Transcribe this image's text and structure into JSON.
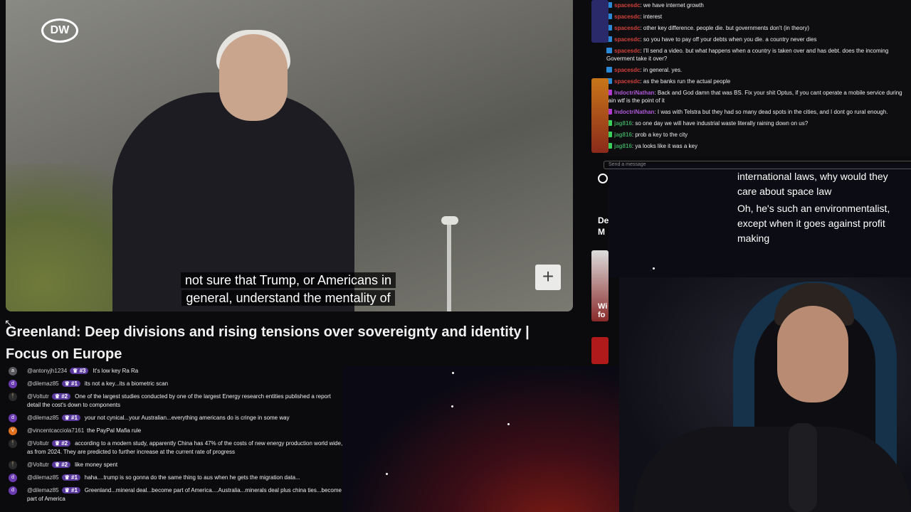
{
  "video": {
    "logo_text": "DW",
    "subtitle_line1": "not sure that Trump, or Americans in",
    "subtitle_line2": "general, understand the mentality of",
    "add_label": "+",
    "title": "Greenland: Deep divisions and rising tensions over sovereignty and identity | Focus on Europe"
  },
  "comments": [
    {
      "avatar": "a",
      "avatar_color": "#5a5a60",
      "user": "@antonyjh1234",
      "badge": "♛ #3",
      "text": "It's low key Ra Ra"
    },
    {
      "avatar": "d",
      "avatar_color": "#6a3ab0",
      "user": "@dilemaz85",
      "badge": "♛ #1",
      "text": "its not a key...its a biometric scan"
    },
    {
      "avatar": "🕴",
      "avatar_color": "#2a2a2a",
      "user": "@Voltutr",
      "badge": "♛ #2",
      "text": "One of the largest studies conducted by one of the largest Energy research entities published a report detail the cost's down to components"
    },
    {
      "avatar": "d",
      "avatar_color": "#6a3ab0",
      "user": "@dilemaz85",
      "badge": "♛ #1",
      "text": "your not cynical...your Australian...everything americans do is cringe in some way"
    },
    {
      "avatar": "V",
      "avatar_color": "#e0701c",
      "user": "@vincentcacciola7161",
      "badge": "",
      "text": "the PayPal Mafia rule"
    },
    {
      "avatar": "🕴",
      "avatar_color": "#2a2a2a",
      "user": "@Voltutr",
      "badge": "♛ #2",
      "text": "according to a modern study, apparently China has 47% of the costs of new energy production world wide, as from 2024. They are predicted to further increase at the current rate of progress"
    },
    {
      "avatar": "🕴",
      "avatar_color": "#2a2a2a",
      "user": "@Voltutr",
      "badge": "♛ #2",
      "text": "like money spent"
    },
    {
      "avatar": "d",
      "avatar_color": "#6a3ab0",
      "user": "@dilemaz85",
      "badge": "♛ #1",
      "text": "haha....trump is so gonna do the same thing to aus when he gets the migration data..."
    },
    {
      "avatar": "d",
      "avatar_color": "#6a3ab0",
      "user": "@dilemaz85",
      "badge": "♛ #1",
      "text": "Greenland...mineral deal...become part of America....Australia...minerals deal plus china ties...become part of America"
    }
  ],
  "chat": [
    {
      "user": "spacesdc",
      "color": "#d0403a",
      "ico": "#2a8ad8",
      "text": ": we have internet growth"
    },
    {
      "user": "spacesdc",
      "color": "#d0403a",
      "ico": "#2a8ad8",
      "text": ": interest"
    },
    {
      "user": "spacesdc",
      "color": "#d0403a",
      "ico": "#2a8ad8",
      "text": ": other key difference. people die. but governments don't (in theory)"
    },
    {
      "user": "spacesdc",
      "color": "#d0403a",
      "ico": "#2a8ad8",
      "text": ": so you have to pay off your debts when you die. a country never dies"
    },
    {
      "user": "spacesdc",
      "color": "#d0403a",
      "ico": "#2a8ad8",
      "text": ": I'll send a video. but what happens when a country is taken over and has debt. does the incoming Goverment take it over?"
    },
    {
      "user": "spacesdc",
      "color": "#d0403a",
      "ico": "#2a8ad8",
      "text": ": in general. yes."
    },
    {
      "user": "spacesdc",
      "color": "#d0403a",
      "ico": "#2a8ad8",
      "text": ": as the banks run the actual people"
    },
    {
      "user": "IndoctriNathan",
      "color": "#b05ad8",
      "ico": "#b03ad0",
      "text": ": Back and God damn that was BS. Fix your shit Optus, if you cant operate a mobile service during rain wtf is the point of it"
    },
    {
      "user": "IndoctriNathan",
      "color": "#b05ad8",
      "ico": "#b03ad0",
      "text": ": I was with Telstra but they had so many dead spots in the cities, and I dont go rural enough."
    },
    {
      "user": "jag816",
      "color": "#3aa05a",
      "ico": "#3ad05a",
      "text": ": so one day we will have industrial waste literally raining down on us?"
    },
    {
      "user": "jag816",
      "color": "#3aa05a",
      "ico": "#3ad05a",
      "text": ": prob a key to the city"
    },
    {
      "user": "jag816",
      "color": "#3aa05a",
      "ico": "#3ad05a",
      "text": ": ya looks like it was a key"
    }
  ],
  "chat_input_placeholder": "Send a message",
  "side_thumbs": {
    "text1": "De",
    "text2": "M",
    "text3": "Wi",
    "text4": "fo"
  },
  "captions": [
    "international laws, why would they care about space law",
    "Oh, he's such an environmentalist, except when it goes against profit making"
  ]
}
